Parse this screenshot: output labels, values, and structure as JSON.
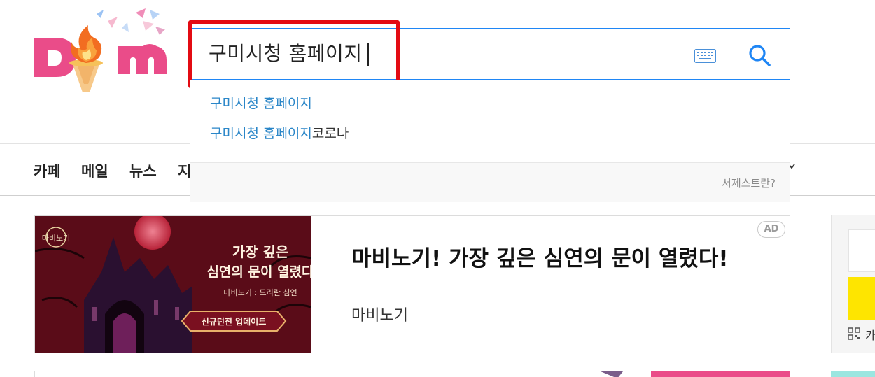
{
  "logo": {
    "text": "Daum",
    "colors": {
      "d": "#ea4c89",
      "flame": "#f26d21",
      "m": "#ea4c89"
    }
  },
  "search": {
    "query": "구미시청 홈페이지"
  },
  "suggestions": [
    {
      "match": "구미시청 홈페이지",
      "rest": ""
    },
    {
      "match": "구미시청 홈페이지",
      "rest": "코로나"
    }
  ],
  "suggest_help": "서제스트란?",
  "nav": [
    "카페",
    "메일",
    "뉴스",
    "지"
  ],
  "ad": {
    "title": "마비노기! 가장 깊은 심연의 문이 열렸다!",
    "advertiser": "마비노기",
    "badge": "AD",
    "image": {
      "logo": "마비노기",
      "headline_1": "가장 깊은",
      "headline_2": "심연의 문이 열렸다",
      "subtitle": "마비노기 : 드리란 심연",
      "button": "신규던전 업데이트"
    }
  },
  "side": {
    "label": "카"
  },
  "colors": {
    "accent": "#1f86f5",
    "highlight": "#e30b13",
    "match": "#2a86c8",
    "kakao_yellow": "#fee500"
  }
}
